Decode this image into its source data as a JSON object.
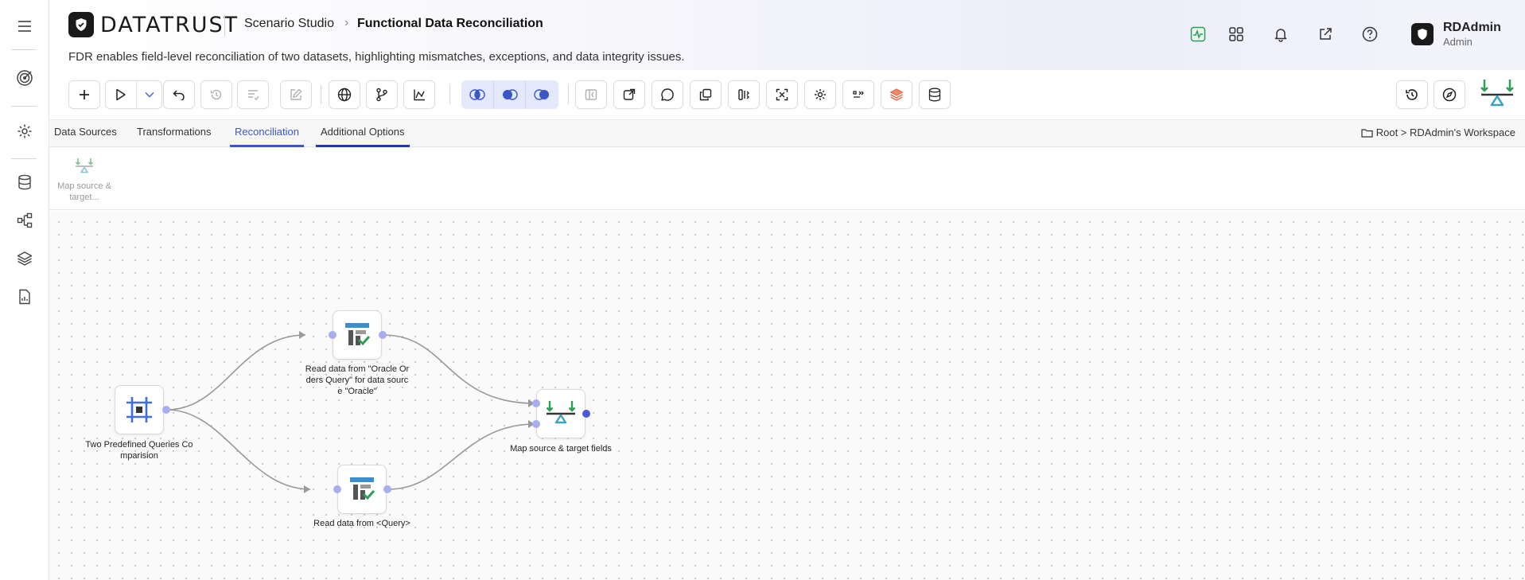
{
  "app": {
    "brand": "DATATRUST",
    "breadcrumb_root": "Scenario Studio",
    "breadcrumb_current": "Functional Data Reconciliation",
    "description": "FDR enables field-level reconciliation of two datasets, highlighting mismatches, exceptions, and data integrity issues."
  },
  "user": {
    "name": "RDAdmin",
    "role": "Admin"
  },
  "tabs": [
    {
      "label": "Data Sources"
    },
    {
      "label": "Transformations"
    },
    {
      "label": "Reconciliation"
    },
    {
      "label": "Additional Options"
    }
  ],
  "active_tab": "Reconciliation",
  "workspace_path": "Root > RDAdmin's Workspace",
  "palette": [
    {
      "label": "Map source & target..."
    }
  ],
  "nodes": [
    {
      "id": "n1",
      "label": "Two Predefined Queries Co mparision",
      "icon": "grid-frame-icon"
    },
    {
      "id": "n2",
      "label": "Read data from \"Oracle Or ders Query\" for data sourc e \"Oracle\"",
      "icon": "read-table-icon"
    },
    {
      "id": "n3",
      "label": "Read data from <Query>",
      "icon": "read-table-icon"
    },
    {
      "id": "n4",
      "label": "Map source & target fields",
      "icon": "scale-map-icon"
    }
  ],
  "colors": {
    "accent": "#3a56c9",
    "port": "#a6aef0",
    "port_dark": "#4a58d9",
    "green": "#2e9e57",
    "teal": "#3aa1c2"
  }
}
